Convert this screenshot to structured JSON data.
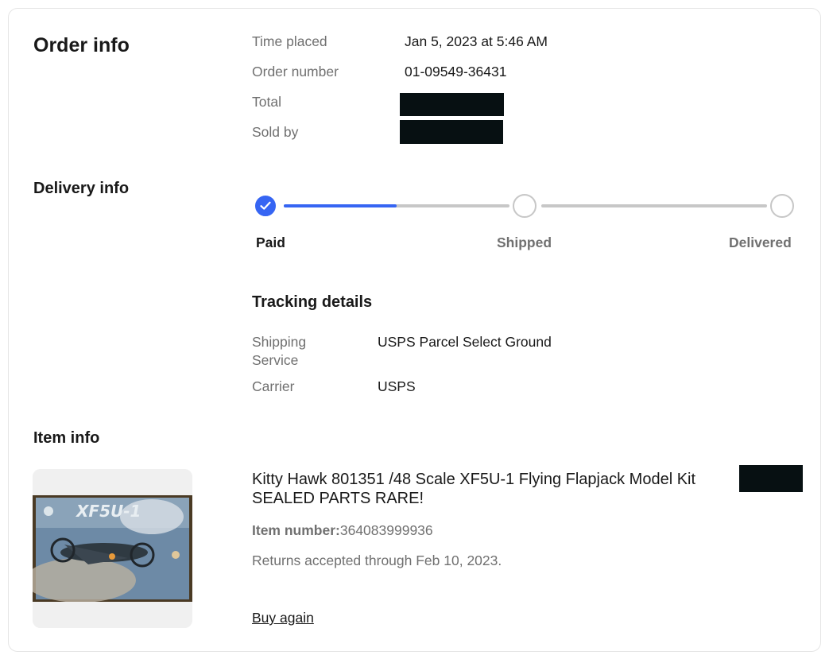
{
  "order": {
    "title": "Order info",
    "fields": [
      {
        "label": "Time placed",
        "value": "Jan 5, 2023 at 5:46 AM"
      },
      {
        "label": "Order number",
        "value": "01-09549-36431"
      },
      {
        "label": "Total",
        "value": ""
      },
      {
        "label": "Sold by",
        "value": ""
      }
    ]
  },
  "delivery": {
    "title": "Delivery info",
    "progress": 0.5,
    "steps": [
      {
        "label": "Paid",
        "status": "complete"
      },
      {
        "label": "Shipped",
        "status": "pending"
      },
      {
        "label": "Delivered",
        "status": "pending"
      }
    ],
    "tracking": {
      "title": "Tracking details",
      "rows": [
        {
          "label": "Shipping Service",
          "value": "USPS Parcel Select Ground"
        },
        {
          "label": "Carrier",
          "value": "USPS"
        }
      ]
    }
  },
  "item": {
    "title": "Item info",
    "name": "Kitty Hawk 801351 /48 Scale XF5U-1 Flying Flapjack Model Kit SEALED PARTS RARE!",
    "number_label": "Item number:",
    "number": "364083999936",
    "returns": "Returns accepted through Feb 10, 2023.",
    "buy_again": "Buy again",
    "image_text": "XF5U-1"
  },
  "colors": {
    "accent": "#3665f3",
    "text": "#191919",
    "muted": "#707070",
    "track": "#c7c7c7",
    "redaction": "#071012"
  }
}
